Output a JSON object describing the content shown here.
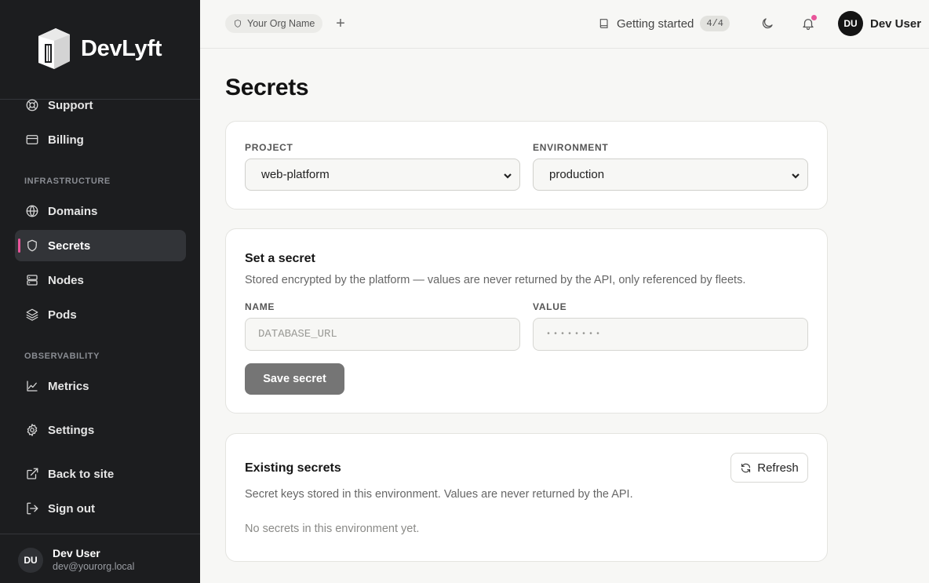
{
  "brand": {
    "name": "DevLyft"
  },
  "sidebar": {
    "top_items": [
      {
        "label": "Support",
        "icon": "lifebuoy-icon"
      },
      {
        "label": "Billing",
        "icon": "credit-card-icon"
      }
    ],
    "sections": [
      {
        "title": "INFRASTRUCTURE"
      },
      {
        "title": "OBSERVABILITY"
      }
    ],
    "infra_items": [
      {
        "label": "Domains",
        "icon": "globe-icon"
      },
      {
        "label": "Secrets",
        "icon": "shield-icon",
        "active": true
      },
      {
        "label": "Nodes",
        "icon": "server-icon"
      },
      {
        "label": "Pods",
        "icon": "layers-icon"
      }
    ],
    "obs_items": [
      {
        "label": "Metrics",
        "icon": "line-chart-icon"
      }
    ],
    "bottom_items": [
      {
        "label": "Settings",
        "icon": "gear-icon"
      },
      {
        "label": "Back to site",
        "icon": "external-link-icon"
      },
      {
        "label": "Sign out",
        "icon": "sign-out-icon"
      }
    ],
    "user": {
      "initials": "DU",
      "name": "Dev User",
      "email": "dev@yourorg.local"
    }
  },
  "topbar": {
    "org_name": "Your Org Name",
    "add_label": "+",
    "getting_started": {
      "label": "Getting started",
      "badge": "4/4"
    },
    "user": {
      "initials": "DU",
      "name": "Dev User"
    }
  },
  "page": {
    "title": "Secrets",
    "filters": {
      "project_label": "PROJECT",
      "project_value": "web-platform",
      "environment_label": "ENVIRONMENT",
      "environment_value": "production"
    },
    "set_secret": {
      "title": "Set a secret",
      "description": "Stored encrypted by the platform — values are never returned by the API, only referenced by fleets.",
      "name_label": "NAME",
      "name_placeholder": "DATABASE_URL",
      "value_label": "VALUE",
      "value_placeholder": "••••••••",
      "save_label": "Save secret"
    },
    "existing": {
      "title": "Existing secrets",
      "description": "Secret keys stored in this environment. Values are never returned by the API.",
      "refresh_label": "Refresh",
      "empty_text": "No secrets in this environment yet."
    }
  },
  "colors": {
    "sidebar_bg": "#1c1d1f",
    "accent": "#e8559a",
    "page_bg": "#f7f7f5",
    "save_button": "#757575"
  }
}
